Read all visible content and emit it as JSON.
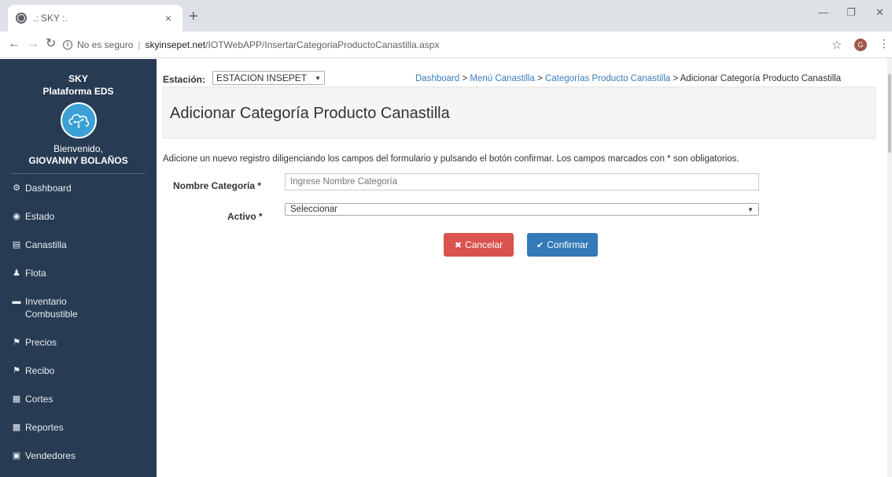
{
  "browser": {
    "tab_title": ".: SKY :.",
    "tab_close": "×",
    "new_tab": "+",
    "security_label": "No es seguro",
    "url_host": "skyinsepet.net",
    "url_path": "/IOTWebAPP/InsertarCategoriaProductoCanastilla.aspx",
    "profile_initial": "G"
  },
  "sidebar": {
    "brand_line1": "SKY",
    "brand_line2": "Plataforma EDS",
    "welcome": "Bienvenido,",
    "username": "GIOVANNY BOLAÑOS",
    "items": [
      {
        "label": "Dashboard",
        "icon": "tachometer-icon"
      },
      {
        "label": "Estado",
        "icon": "eye-icon"
      },
      {
        "label": "Canastilla",
        "icon": "basket-icon"
      },
      {
        "label": "Flota",
        "icon": "users-icon"
      },
      {
        "label": "Inventario Combustible",
        "icon": "battery-icon"
      },
      {
        "label": "Precios",
        "icon": "tags-icon"
      },
      {
        "label": "Recibo",
        "icon": "tag-icon"
      },
      {
        "label": "Cortes",
        "icon": "calendar-icon"
      },
      {
        "label": "Reportes",
        "icon": "bar-chart-icon"
      },
      {
        "label": "Vendedores",
        "icon": "id-card-icon"
      }
    ]
  },
  "header": {
    "station_label": "Estación:",
    "station_value": "ESTACION INSEPET",
    "breadcrumb": [
      {
        "label": "Dashboard",
        "link": true
      },
      {
        "label": "Menú Canastilla",
        "link": true
      },
      {
        "label": "Categorías Producto Canastilla",
        "link": true
      },
      {
        "label": "Adicionar Categoría Producto Canastilla",
        "link": false
      }
    ]
  },
  "main": {
    "title": "Adicionar Categoría Producto Canastilla",
    "intro": "Adicione un nuevo registro diligenciando los campos del formulario y pulsando el botón confirmar. Los campos marcados con * son obligatorios.",
    "form": {
      "name_label": "Nombre Categoría *",
      "name_placeholder": "Ingrese Nombre Categoría",
      "name_value": "",
      "active_label": "Activo *",
      "active_selected": "Seleccionar"
    },
    "buttons": {
      "cancel": "Cancelar",
      "confirm": "Confirmar"
    }
  },
  "colors": {
    "sidebar_bg": "#273b52",
    "cancel_bg": "#d9534f",
    "confirm_bg": "#337ab7",
    "link": "#3a7cbf"
  }
}
